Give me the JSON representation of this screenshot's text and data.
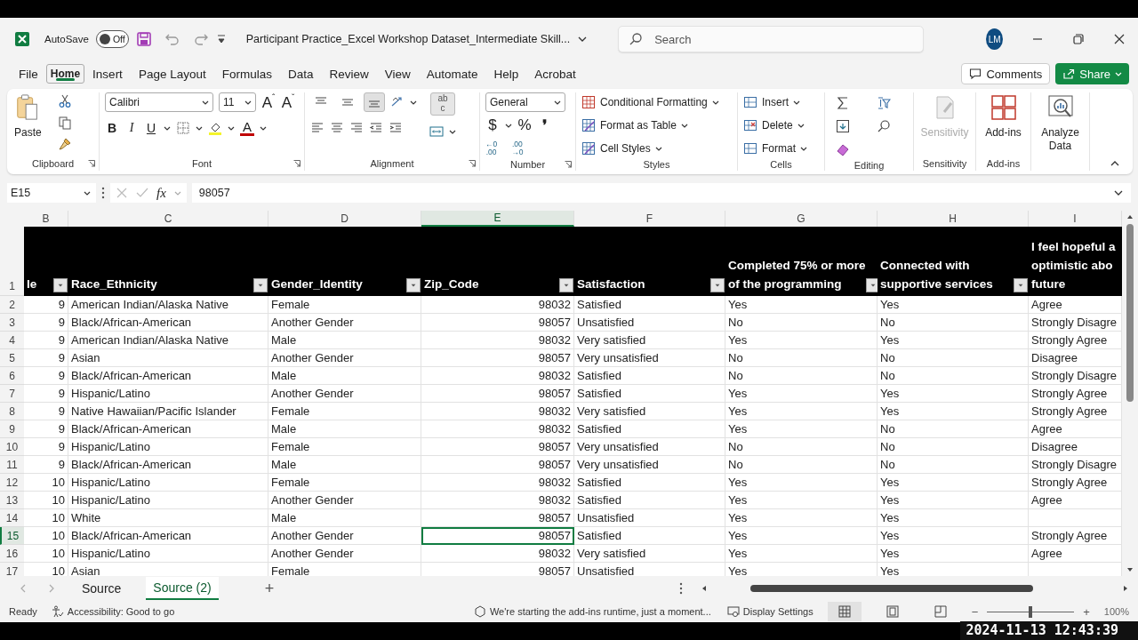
{
  "title_bar": {
    "autosave_label": "AutoSave",
    "autosave_on": false,
    "autosave_state": "Off",
    "document_title": "Participant Practice_Excel Workshop Dataset_Intermediate Skill...",
    "search_placeholder": "Search",
    "user_initials": "LM"
  },
  "menu_tabs": [
    {
      "label": "File",
      "selected": false
    },
    {
      "label": "Home",
      "selected": true
    },
    {
      "label": "Insert",
      "selected": false
    },
    {
      "label": "Page Layout",
      "selected": false
    },
    {
      "label": "Formulas",
      "selected": false
    },
    {
      "label": "Data",
      "selected": false
    },
    {
      "label": "Review",
      "selected": false
    },
    {
      "label": "View",
      "selected": false
    },
    {
      "label": "Automate",
      "selected": false
    },
    {
      "label": "Help",
      "selected": false
    },
    {
      "label": "Acrobat",
      "selected": false
    }
  ],
  "header_buttons": {
    "comments": "Comments",
    "share": "Share"
  },
  "ribbon": {
    "clipboard": {
      "paste": "Paste",
      "label": "Clipboard"
    },
    "font": {
      "name": "Calibri",
      "size": "11",
      "grow": "A",
      "grow_mark": "ˆ",
      "shrink": "A",
      "shrink_mark": "ˇ",
      "styles": [
        "B",
        "I",
        "U"
      ],
      "color_glyph": "A",
      "label": "Font"
    },
    "alignment": {
      "vertical_align_buttons": [
        {
          "selected": false
        },
        {
          "selected": false
        },
        {
          "selected": true
        }
      ],
      "wrap_top": "ab",
      "wrap_bottom": "c",
      "label": "Alignment"
    },
    "number": {
      "format": "General",
      "symbols": [
        "$",
        "%",
        "❜"
      ],
      "decimals": [
        {
          "top": "←0",
          "bottom": ".00"
        },
        {
          "top": ".00",
          "bottom": "→0"
        }
      ],
      "label": "Number"
    },
    "styles": {
      "items": [
        "Conditional Formatting",
        "Format as Table",
        "Cell Styles"
      ],
      "label": "Styles"
    },
    "cells": {
      "items": [
        "Insert",
        "Delete",
        "Format"
      ],
      "label": "Cells"
    },
    "editing": {
      "label": "Editing"
    },
    "sensitivity": {
      "button": "Sensitivity",
      "disabled": true,
      "label": "Sensitivity"
    },
    "addins": {
      "button": "Add-ins",
      "label": "Add-ins"
    },
    "analyze": {
      "button": "Analyze Data"
    }
  },
  "formula_bar": {
    "name_box": "E15",
    "fx": "fx",
    "formula": "98057"
  },
  "sheet": {
    "column_letters": [
      {
        "label": "B",
        "selected": false
      },
      {
        "label": "C",
        "selected": false
      },
      {
        "label": "D",
        "selected": false
      },
      {
        "label": "E",
        "selected": true
      },
      {
        "label": "F",
        "selected": false
      },
      {
        "label": "G",
        "selected": false
      },
      {
        "label": "H",
        "selected": false
      },
      {
        "label": "I",
        "selected": false
      }
    ],
    "header_row_number": "1",
    "headers": [
      {
        "lines": [
          "le"
        ]
      },
      {
        "lines": [
          "Race_Ethnicity"
        ]
      },
      {
        "lines": [
          "Gender_Identity"
        ]
      },
      {
        "lines": [
          "Zip_Code"
        ]
      },
      {
        "lines": [
          "Satisfaction"
        ]
      },
      {
        "lines": [
          "Completed 75% or more",
          "of the programming"
        ]
      },
      {
        "lines": [
          "Connected with",
          "supportive services"
        ]
      },
      {
        "lines": [
          "I feel hopeful a",
          "optimistic abo",
          "future"
        ]
      }
    ],
    "rows": [
      {
        "number": "2",
        "selected": false,
        "cells": {
          "b": "9",
          "c": "American Indian/Alaska Native",
          "d": "Female",
          "e": "98032",
          "f": "Satisfied",
          "g": "Yes",
          "h": "Yes",
          "i": "Agree"
        }
      },
      {
        "number": "3",
        "selected": false,
        "cells": {
          "b": "9",
          "c": "Black/African-American",
          "d": "Another Gender",
          "e": "98057",
          "f": "Unsatisfied",
          "g": "No",
          "h": "No",
          "i": "Strongly Disagre"
        }
      },
      {
        "number": "4",
        "selected": false,
        "cells": {
          "b": "9",
          "c": "American Indian/Alaska Native",
          "d": "Male",
          "e": "98032",
          "f": "Very satisfied",
          "g": "Yes",
          "h": "Yes",
          "i": "Strongly Agree"
        }
      },
      {
        "number": "5",
        "selected": false,
        "cells": {
          "b": "9",
          "c": "Asian",
          "d": "Another Gender",
          "e": "98057",
          "f": "Very unsatisfied",
          "g": "No",
          "h": "No",
          "i": "Disagree"
        }
      },
      {
        "number": "6",
        "selected": false,
        "cells": {
          "b": "9",
          "c": "Black/African-American",
          "d": "Male",
          "e": "98032",
          "f": "Satisfied",
          "g": "No",
          "h": "No",
          "i": "Strongly Disagre"
        }
      },
      {
        "number": "7",
        "selected": false,
        "cells": {
          "b": "9",
          "c": "Hispanic/Latino",
          "d": "Another Gender",
          "e": "98057",
          "f": "Satisfied",
          "g": "Yes",
          "h": "Yes",
          "i": "Strongly Agree"
        }
      },
      {
        "number": "8",
        "selected": false,
        "cells": {
          "b": "9",
          "c": "Native Hawaiian/Pacific Islander",
          "d": "Female",
          "e": "98032",
          "f": "Very satisfied",
          "g": "Yes",
          "h": "Yes",
          "i": "Strongly Agree"
        }
      },
      {
        "number": "9",
        "selected": false,
        "cells": {
          "b": "9",
          "c": "Black/African-American",
          "d": "Male",
          "e": "98032",
          "f": "Satisfied",
          "g": "Yes",
          "h": "No",
          "i": "Agree"
        }
      },
      {
        "number": "10",
        "selected": false,
        "cells": {
          "b": "9",
          "c": "Hispanic/Latino",
          "d": "Female",
          "e": "98057",
          "f": "Very unsatisfied",
          "g": "No",
          "h": "No",
          "i": "Disagree"
        }
      },
      {
        "number": "11",
        "selected": false,
        "cells": {
          "b": "9",
          "c": "Black/African-American",
          "d": "Male",
          "e": "98057",
          "f": "Very unsatisfied",
          "g": "No",
          "h": "No",
          "i": "Strongly Disagre"
        }
      },
      {
        "number": "12",
        "selected": false,
        "cells": {
          "b": "10",
          "c": "Hispanic/Latino",
          "d": "Female",
          "e": "98032",
          "f": "Satisfied",
          "g": "Yes",
          "h": "Yes",
          "i": "Strongly Agree"
        }
      },
      {
        "number": "13",
        "selected": false,
        "cells": {
          "b": "10",
          "c": "Hispanic/Latino",
          "d": "Another Gender",
          "e": "98032",
          "f": "Satisfied",
          "g": "Yes",
          "h": "Yes",
          "i": "Agree"
        }
      },
      {
        "number": "14",
        "selected": false,
        "cells": {
          "b": "10",
          "c": "White",
          "d": "Male",
          "e": "98057",
          "f": "Unsatisfied",
          "g": "Yes",
          "h": "Yes"
        }
      },
      {
        "number": "15",
        "selected": true,
        "cells": {
          "b": "10",
          "c": "Black/African-American",
          "d": "Another Gender",
          "e": "98057",
          "f": "Satisfied",
          "g": "Yes",
          "h": "Yes",
          "i": "Strongly Agree"
        }
      },
      {
        "number": "16",
        "selected": false,
        "cells": {
          "b": "10",
          "c": "Hispanic/Latino",
          "d": "Another Gender",
          "e": "98032",
          "f": "Very satisfied",
          "g": "Yes",
          "h": "Yes",
          "i": "Agree"
        }
      },
      {
        "number": "17",
        "selected": false,
        "cells": {
          "b": "10",
          "c": "Asian",
          "d": "Female",
          "e": "98057",
          "f": "Unsatisfied",
          "g": "Yes",
          "h": "Yes"
        }
      }
    ]
  },
  "sheet_tabs": [
    {
      "label": "Source",
      "selected": false
    },
    {
      "label": "Source (2)",
      "selected": true
    }
  ],
  "add_sheet": "+",
  "status_bar": {
    "ready": "Ready",
    "accessibility": "Accessibility: Good to go",
    "message": "We're starting the add-ins runtime, just a moment...",
    "display_settings": "Display Settings",
    "views": [
      {
        "kind": "normal",
        "selected": true
      },
      {
        "kind": "page-layout",
        "selected": false
      },
      {
        "kind": "page-break",
        "selected": false
      }
    ],
    "zoom_out": "−",
    "zoom_in": "+",
    "zoom": {
      "level": 0.5
    },
    "zoom_text": "100%"
  },
  "timestamp": "2024-11-13 12:43:39"
}
